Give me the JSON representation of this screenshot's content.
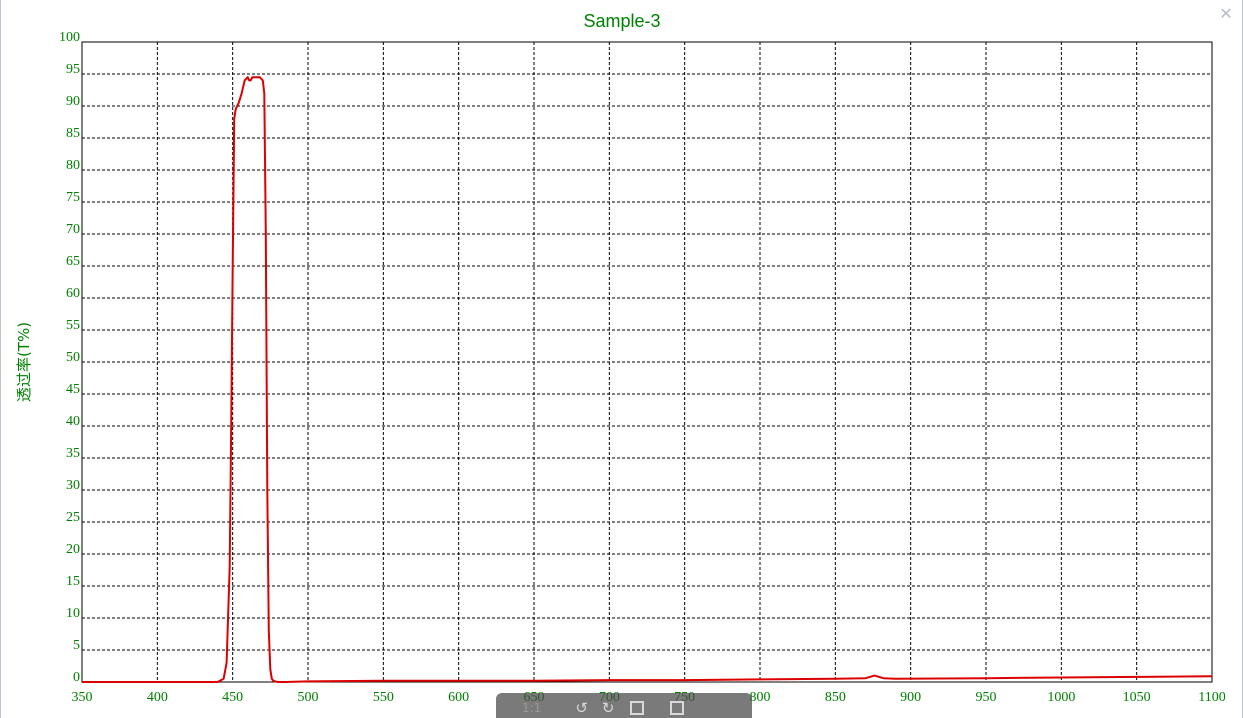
{
  "window": {
    "close_icon": "close-icon"
  },
  "chart_data": {
    "type": "line",
    "title": "Sample-3",
    "xlabel": "",
    "ylabel": "透过率(T%)",
    "xlim": [
      350,
      1100
    ],
    "ylim": [
      0,
      100
    ],
    "x_ticks": [
      350,
      400,
      450,
      500,
      550,
      600,
      650,
      700,
      750,
      800,
      850,
      900,
      950,
      1000,
      1050,
      1100
    ],
    "y_ticks": [
      0,
      5,
      10,
      15,
      20,
      25,
      30,
      35,
      40,
      45,
      50,
      55,
      60,
      65,
      70,
      75,
      80,
      85,
      90,
      95,
      100
    ],
    "grid": true,
    "legend": "none",
    "colors": {
      "text": "#008000",
      "series": "#dd0000",
      "grid": "#000000",
      "axis": "#000000"
    },
    "series": [
      {
        "name": "",
        "x": [
          350,
          400,
          440,
          444,
          446,
          448,
          449,
          450,
          451,
          452,
          454,
          456,
          458,
          460,
          461,
          462,
          463,
          464,
          466,
          468,
          470,
          471,
          472,
          473,
          474,
          475,
          476,
          477,
          478,
          480,
          485,
          500,
          550,
          600,
          650,
          700,
          750,
          800,
          850,
          870,
          876,
          882,
          890,
          950,
          1000,
          1050,
          1100
        ],
        "y": [
          0,
          0,
          0,
          0.5,
          3,
          18,
          40,
          65,
          88,
          89.5,
          90.5,
          92,
          94,
          94.5,
          94,
          94,
          94.5,
          94.5,
          94.5,
          94.5,
          94,
          92,
          70,
          30,
          8,
          2,
          0.5,
          0.2,
          0.1,
          0,
          0,
          0.1,
          0.2,
          0.2,
          0.2,
          0.3,
          0.3,
          0.4,
          0.5,
          0.6,
          1.0,
          0.6,
          0.5,
          0.6,
          0.7,
          0.8,
          0.9
        ]
      }
    ]
  },
  "toolbar": {
    "ratio_label": "1:1",
    "rotate_left_label": "↺",
    "rotate_right_label": "↻"
  }
}
